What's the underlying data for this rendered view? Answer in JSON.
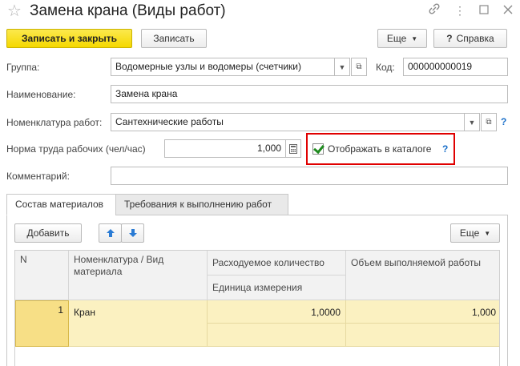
{
  "window": {
    "title": "Замена крана (Виды работ)"
  },
  "toolbar": {
    "save_close_label": "Записать и закрыть",
    "save_label": "Записать",
    "more_label": "Еще",
    "help_label": "Справка"
  },
  "form": {
    "group_label": "Группа:",
    "group_value": "Водомерные узлы и водомеры (счетчики)",
    "code_label": "Код:",
    "code_value": "000000000019",
    "name_label": "Наименование:",
    "name_value": "Замена крана",
    "nomenclature_label": "Номенклатура работ:",
    "nomenclature_value": "Сантехнические работы",
    "labor_norm_label": "Норма труда рабочих (чел/час)",
    "labor_norm_value": "1,000",
    "show_in_catalog_label": "Отображать в каталоге",
    "show_in_catalog_checked": true,
    "comment_label": "Комментарий:",
    "comment_value": "",
    "help_mark": "?"
  },
  "tabs": [
    {
      "label": "Состав материалов",
      "active": true
    },
    {
      "label": "Требования к выполнению работ",
      "active": false
    }
  ],
  "table_toolbar": {
    "add_label": "Добавить",
    "more_label": "Еще"
  },
  "table": {
    "headers": {
      "n": "N",
      "material": "Номенклатура / Вид материала",
      "consumption": "Расходуемое количество",
      "unit": "Единица измерения",
      "work_volume": "Объем выполняемой работы"
    },
    "rows": [
      {
        "n": "1",
        "material": "Кран",
        "consumption": "1,0000",
        "unit": "",
        "work_volume": "1,000"
      }
    ]
  },
  "colors": {
    "primary_button": "#f5d800",
    "highlight_border": "#e00000",
    "help": "#1a6fc9",
    "selected_row": "#fbf1c1"
  }
}
